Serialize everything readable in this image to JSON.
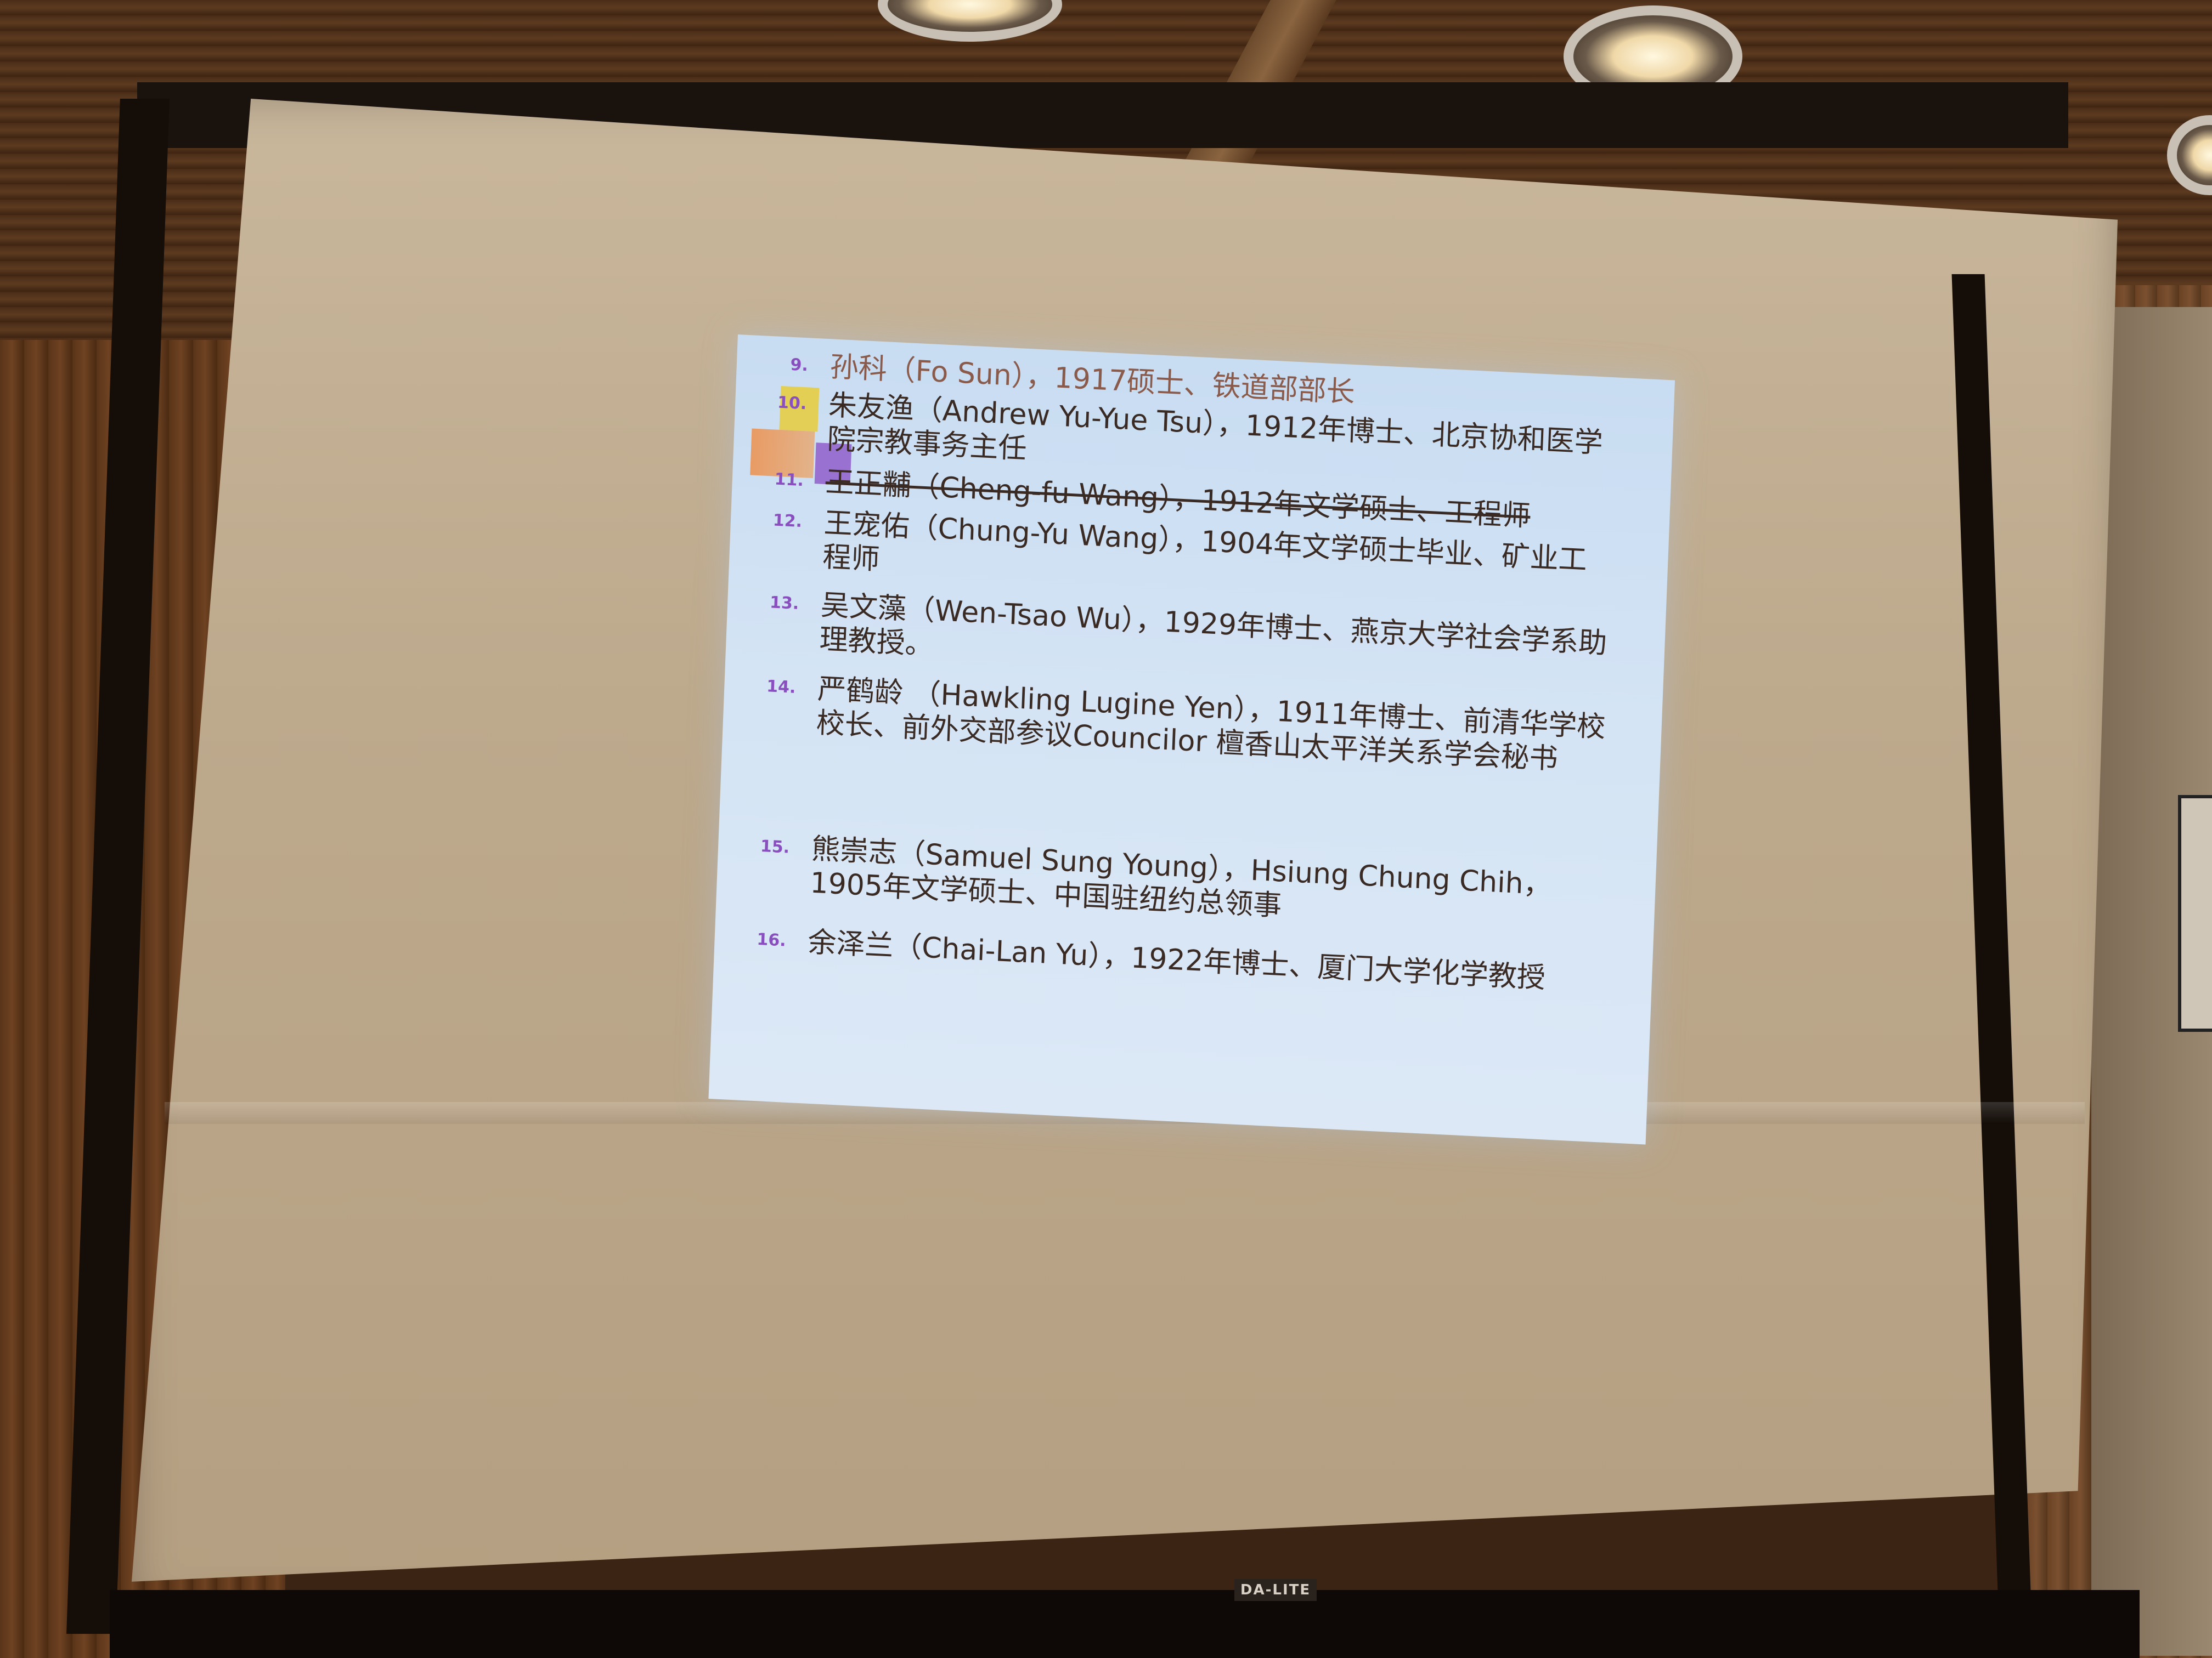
{
  "screen": {
    "brand_label": "DA-LITE"
  },
  "slide": {
    "items": [
      {
        "num": "9.",
        "text": "孙科（Fo Sun），1917硕士、铁道部部长"
      },
      {
        "num": "10.",
        "text": "朱友渔（Andrew Yu-Yue Tsu），1912年博士、北京协和医学院宗教事务主任"
      },
      {
        "num": "11.",
        "text": "王正黼（Cheng-fu Wang），1912年文学硕士、工程师"
      },
      {
        "num": "12.",
        "text": "王宠佑（Chung-Yu Wang），1904年文学硕士毕业、矿业工程师"
      },
      {
        "num": "13.",
        "text": "吴文藻（Wen-Tsao Wu），1929年博士、燕京大学社会学系助理教授。"
      },
      {
        "num": "14.",
        "text": "严鹤龄 （Hawkling Lugine Yen），1911年博士、前清华学校校长、前外交部参议Councilor 檀香山太平洋关系学会秘书"
      },
      {
        "num": "15.",
        "text": "熊崇志（Samuel Sung Young），Hsiung Chung Chih，1905年文学硕士、中国驻纽约总领事"
      },
      {
        "num": "16.",
        "text": "余泽兰（Chai-Lan Yu），1922年博士、厦门大学化学教授"
      }
    ]
  }
}
